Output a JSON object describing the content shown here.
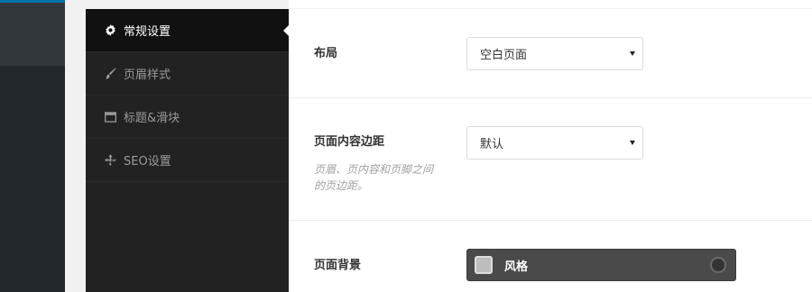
{
  "tabs": [
    {
      "label": "常规设置",
      "icon": "gear-icon",
      "active": true
    },
    {
      "label": "页眉样式",
      "icon": "brush-icon",
      "active": false
    },
    {
      "label": "标题&滑块",
      "icon": "window-icon",
      "active": false
    },
    {
      "label": "SEO设置",
      "icon": "crosshair-icon",
      "active": false
    }
  ],
  "fields": {
    "layout": {
      "label": "布局",
      "value": "空白页面"
    },
    "content_padding": {
      "label": "页面内容边距",
      "value": "默认",
      "description": "页眉、页内容和页脚之间的页边距。"
    },
    "page_background": {
      "label": "页面背景",
      "value": "风格"
    }
  },
  "colors": {
    "tab_panel": "#222222",
    "tab_active": "#111111",
    "admin_accent": "#0073aa",
    "style_picker": "#4a4a4a"
  }
}
